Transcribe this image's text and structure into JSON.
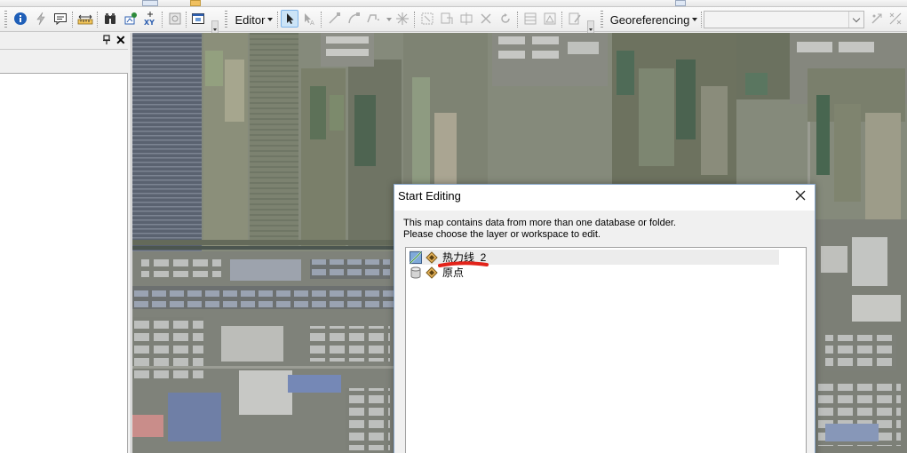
{
  "toolbar": {
    "editor_menu": "Editor",
    "georeferencing_menu": "Georeferencing",
    "layer_combo_value": "",
    "accent_color": "#cce4f7",
    "icons": [
      "info-icon",
      "lightning-icon",
      "html-popup-icon",
      "measure-icon",
      "find-binoculars-icon",
      "find-route-icon",
      "goto-xy-icon",
      "create-viewer-icon",
      "magnifier-window-icon",
      "edit-tool-icon",
      "edit-annotation-icon",
      "straight-segment-icon",
      "endpoint-arc-icon",
      "trace-icon",
      "point-icon",
      "edit-vertices-icon",
      "reshape-icon",
      "cut-polygons-icon",
      "split-icon",
      "rotate-icon",
      "attributes-icon",
      "sketch-properties-icon",
      "create-features-icon",
      "rotate-georef-icon",
      "add-control-points-icon"
    ]
  },
  "left_panel": {
    "pin_icon": "pin-icon",
    "close_label": "✕"
  },
  "dialog": {
    "title": "Start Editing",
    "message_line1": "This map contains data from more than one database or folder.",
    "message_line2": "Please choose the layer or workspace to edit.",
    "items": [
      {
        "label": "热力线_2",
        "icon": "feature-class-icon",
        "selected": true
      },
      {
        "label": "原点",
        "icon": "database-icon",
        "selected": false
      }
    ]
  },
  "annotations": {
    "marker_color": "#e2231a"
  }
}
